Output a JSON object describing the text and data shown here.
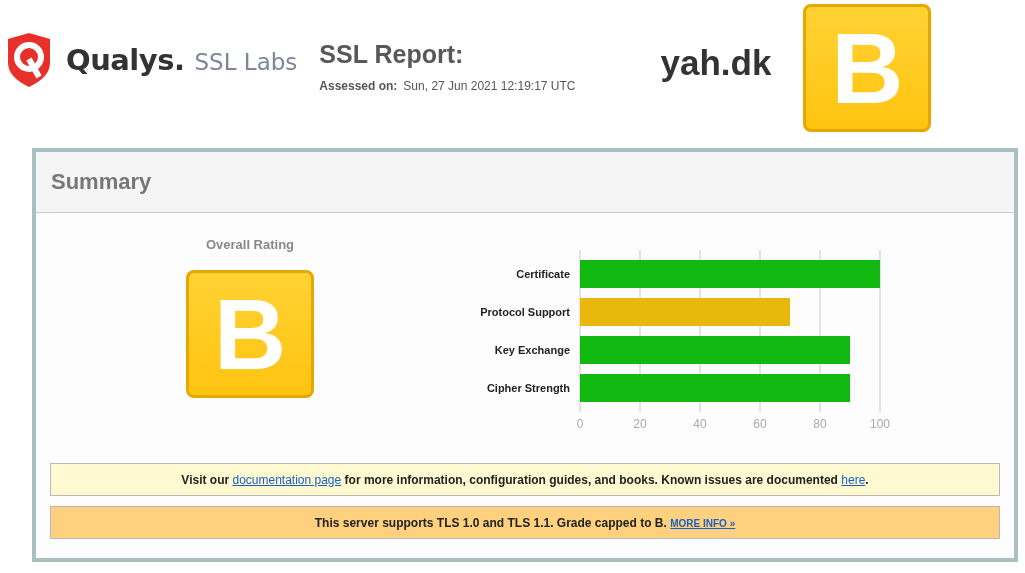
{
  "header": {
    "logo": {
      "brand": "Qualys.",
      "product": "SSL Labs"
    },
    "report_title": "SSL Report:",
    "assessed_label": "Assessed on:",
    "assessed_value": "Sun, 27 Jun 2021 12:19:17 UTC",
    "host": "yah.dk",
    "grade": "B"
  },
  "summary": {
    "title": "Summary",
    "rating_label": "Overall Rating",
    "grade": "B",
    "chart_data": {
      "type": "bar",
      "orientation": "horizontal",
      "categories": [
        "Certificate",
        "Protocol Support",
        "Key Exchange",
        "Cipher Strength"
      ],
      "series": [
        {
          "color": "#11b911",
          "values": [
            100,
            null,
            90,
            90
          ]
        },
        {
          "color": "#e8b90c",
          "values": [
            null,
            70,
            null,
            null
          ]
        }
      ],
      "grid": true,
      "xlim": [
        0,
        100
      ],
      "xticks": [
        0,
        20,
        40,
        60,
        80,
        100
      ]
    },
    "notices": [
      {
        "kind": "info",
        "parts": [
          {
            "kind": "text",
            "text": "Visit our "
          },
          {
            "kind": "link",
            "text": "documentation page"
          },
          {
            "kind": "text",
            "text": " for more information, configuration guides, and books. Known issues are documented "
          },
          {
            "kind": "link",
            "text": "here"
          },
          {
            "kind": "text",
            "text": "."
          }
        ]
      },
      {
        "kind": "warning",
        "parts": [
          {
            "kind": "text",
            "text": "This server supports TLS 1.0 and TLS 1.1. Grade capped to B. "
          },
          {
            "kind": "small-link",
            "text": "MORE INFO »"
          }
        ]
      }
    ]
  }
}
